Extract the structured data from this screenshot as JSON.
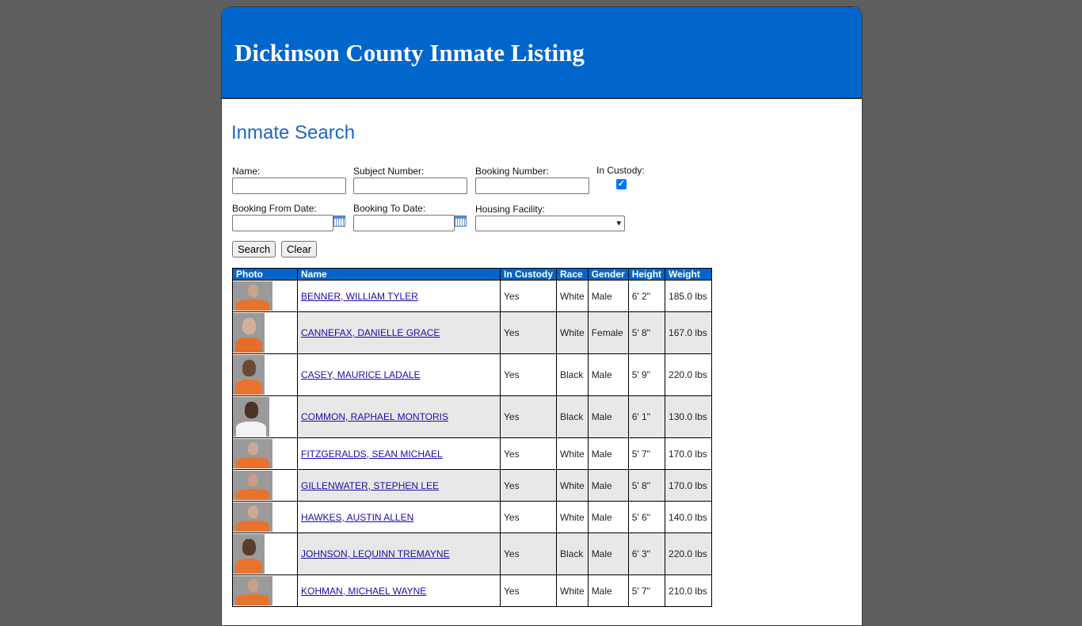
{
  "header": {
    "title": "Dickinson County Inmate Listing"
  },
  "search": {
    "title": "Inmate Search",
    "name_label": "Name:",
    "subject_label": "Subject Number:",
    "booking_label": "Booking Number:",
    "in_custody_label": "In Custody:",
    "in_custody_checked": true,
    "from_date_label": "Booking From Date:",
    "to_date_label": "Booking To Date:",
    "facility_label": "Housing Facility:",
    "facility_value": "",
    "search_button": "Search",
    "clear_button": "Clear"
  },
  "table": {
    "headers": [
      "Photo",
      "Name",
      "In Custody",
      "Race",
      "Gender",
      "Height",
      "Weight"
    ],
    "rows": [
      {
        "name": "BENNER, WILLIAM TYLER",
        "custody": "Yes",
        "race": "White",
        "gender": "Male",
        "height": "6' 2\"",
        "weight": "185.0 lbs",
        "skin": "#c9a58c",
        "shirt": "#e8732e"
      },
      {
        "name": "CANNEFAX, DANIELLE GRACE",
        "custody": "Yes",
        "race": "White",
        "gender": "Female",
        "height": "5' 8\"",
        "weight": "167.0 lbs",
        "skin": "#d4b09a",
        "shirt": "#e36f2a"
      },
      {
        "name": "CASEY, MAURICE LADALE",
        "custody": "Yes",
        "race": "Black",
        "gender": "Male",
        "height": "5' 9\"",
        "weight": "220.0 lbs",
        "skin": "#6b4a35",
        "shirt": "#e8732e"
      },
      {
        "name": "COMMON, RAPHAEL MONTORIS",
        "custody": "Yes",
        "race": "Black",
        "gender": "Male",
        "height": "6' 1\"",
        "weight": "130.0 lbs",
        "skin": "#4a3224",
        "shirt": "#f2f2f2"
      },
      {
        "name": "FITZGERALDS, SEAN MICHAEL",
        "custody": "Yes",
        "race": "White",
        "gender": "Male",
        "height": "5' 7\"",
        "weight": "170.0 lbs",
        "skin": "#cfa996",
        "shirt": "#e8732e"
      },
      {
        "name": "GILLENWATER, STEPHEN LEE",
        "custody": "Yes",
        "race": "White",
        "gender": "Male",
        "height": "5' 8\"",
        "weight": "170.0 lbs",
        "skin": "#c99d86",
        "shirt": "#e8732e"
      },
      {
        "name": "HAWKES, AUSTIN ALLEN",
        "custody": "Yes",
        "race": "White",
        "gender": "Male",
        "height": "5' 6\"",
        "weight": "140.0 lbs",
        "skin": "#d0a892",
        "shirt": "#e8732e"
      },
      {
        "name": "JOHNSON, LEQUINN TREMAYNE",
        "custody": "Yes",
        "race": "Black",
        "gender": "Male",
        "height": "6' 3\"",
        "weight": "220.0 lbs",
        "skin": "#5a3c2a",
        "shirt": "#e8732e"
      },
      {
        "name": "KOHMAN, MICHAEL WAYNE",
        "custody": "Yes",
        "race": "White",
        "gender": "Male",
        "height": "5' 7\"",
        "weight": "210.0 lbs",
        "skin": "#c9a08a",
        "shirt": "#e8732e"
      }
    ]
  }
}
